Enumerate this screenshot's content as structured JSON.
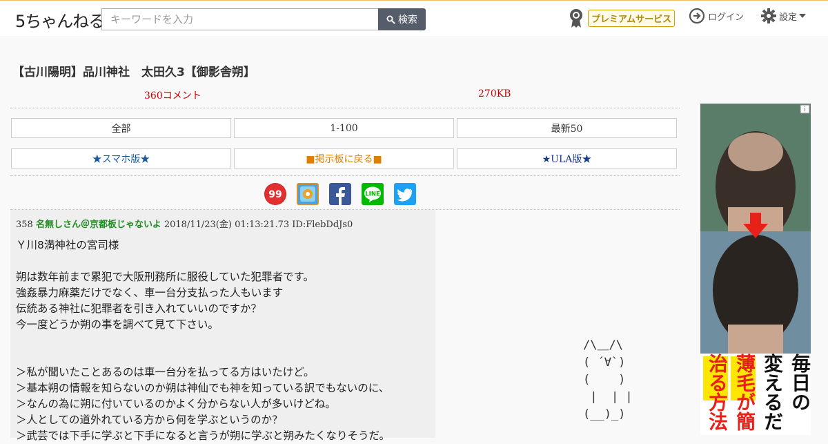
{
  "header": {
    "logo": "5ちゃんねる",
    "search_placeholder": "キーワードを入力",
    "search_label": "検索",
    "premium_label": "プレミアムサービス",
    "login_label": "ログイン",
    "settings_label": "設定"
  },
  "thread": {
    "title": "【古川陽明】品川神社　太田久3【御影舎朔】",
    "comments": "360コメント",
    "size": "270KB"
  },
  "nav": {
    "all": "全部",
    "range": "1-100",
    "latest": "最新50",
    "smartphone": "★スマホ版★",
    "back": "■掲示板に戻る■",
    "ula": "★ULA版★"
  },
  "share": {
    "icons": [
      "5ch-99-icon",
      "bookmark-icon",
      "facebook-icon",
      "line-icon",
      "twitter-icon"
    ]
  },
  "post": {
    "number": "358",
    "name": "名無しさん＠京都板じゃないよ",
    "datetime": "2018/11/23(金) 01:13:21.73",
    "id": "ID:FlebDdJs0",
    "body": "Ｙ川8満神社の宮司様\n\n朔は数年前まで累犯で大阪刑務所に服役していた犯罪者です。\n強姦暴力麻薬だけでなく、車一台分支払った人もいます\n伝統ある神社に犯罪者を引き入れていいのですか？\n今一度どうか朔の事を調べて見て下さい。\n\n\n＞私が聞いたことあるのは車一台分を払ってる方はいたけど。\n＞基本朔の情報を知らないのか朔は神仙でも神を知っている訳でもないのに、\n＞なんの為に朔に付いているのかよく分からない人が多いけどね。\n＞人としての道外れている方から何を学ぶというのか？\n＞武芸では下手に学ぶと下手になると言うが朔に学ぶと朔みたくなりそうだ。"
  },
  "ascii_art": "/\\＿/\\\n( ´∀`)\n(    )\n |  | |\n(__)_)",
  "ad": {
    "text_1": "毎日の",
    "text_2": "変えるだ",
    "text_3": "薄毛が簡",
    "text_4": "治る方法"
  },
  "colors": {
    "accent": "#f28a1a",
    "comment_red": "#c00000",
    "name_green": "#228b22",
    "link_blue": "#1a5a9a",
    "link_orange": "#e08000"
  }
}
